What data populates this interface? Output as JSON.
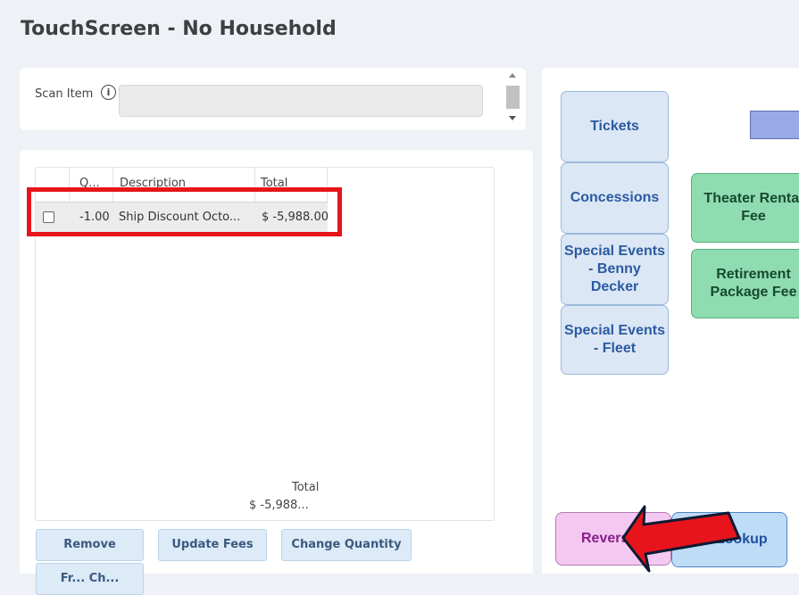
{
  "page": {
    "title": "TouchScreen - No Household"
  },
  "scan": {
    "label": "Scan Item",
    "info_glyph": "i",
    "input_value": ""
  },
  "cart": {
    "columns": [
      "Q...",
      "Description",
      "Total"
    ],
    "rows": [
      {
        "checked": false,
        "qty": "-1.00",
        "description": "Ship Discount Octo...",
        "total": "$ -5,988.00"
      }
    ],
    "total_label": "Total",
    "total_value": "$ -5,988..."
  },
  "actions": {
    "remove": "Remove",
    "update_fees": "Update Fees",
    "change_quantity": "Change Quantity",
    "second_row_partial": "Fr... Ch..."
  },
  "categories": [
    "Tickets",
    "Concessions",
    "Special Events - Benny Decker",
    "Special Events - Fleet"
  ],
  "fees": [
    "Theater Rental Fee",
    "Retirement Package Fee"
  ],
  "bottom": {
    "reverse": "Reverse",
    "hh_lookup": "HH Lookup"
  },
  "colors": {
    "highlight": "#e8141b",
    "category_bg": "#dbe7f5",
    "fee_bg": "#8fdcb1",
    "reverse_bg": "#f3c8f1",
    "hh_bg": "#bfdcf7"
  },
  "annotations": {
    "highlight_target": "cart row",
    "arrow_target": "Reverse"
  }
}
